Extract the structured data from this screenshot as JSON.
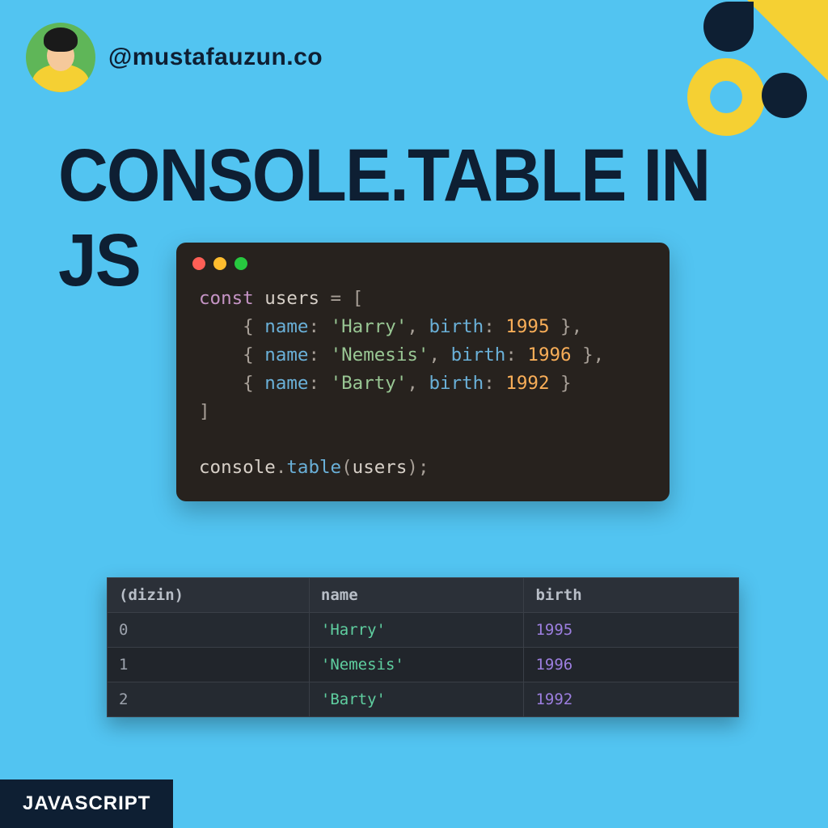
{
  "header": {
    "handle": "@mustafauzun.co"
  },
  "title": "CONSOLE.TABLE IN JS",
  "code": {
    "keyword_const": "const",
    "var_users": "users",
    "eq_open": " = [",
    "row_open": "    { ",
    "prop_name": "name",
    "colon": ": ",
    "comma_sp": ", ",
    "prop_birth": "birth",
    "row_close": " }",
    "row_close_comma": " },",
    "close_bracket": "]",
    "names": [
      "'Harry'",
      "'Nemesis'",
      "'Barty'"
    ],
    "births": [
      "1995",
      "1996",
      "1992"
    ],
    "console": "console",
    "dot": ".",
    "table_fn": "table",
    "paren_open": "(",
    "paren_close": ")",
    "semicolon": ";"
  },
  "output": {
    "headers": {
      "index": "(dizin)",
      "name": "name",
      "birth": "birth"
    },
    "rows": [
      {
        "index": "0",
        "name": "'Harry'",
        "birth": "1995"
      },
      {
        "index": "1",
        "name": "'Nemesis'",
        "birth": "1996"
      },
      {
        "index": "2",
        "name": "'Barty'",
        "birth": "1992"
      }
    ]
  },
  "footer": {
    "tag": "JAVASCRIPT"
  }
}
